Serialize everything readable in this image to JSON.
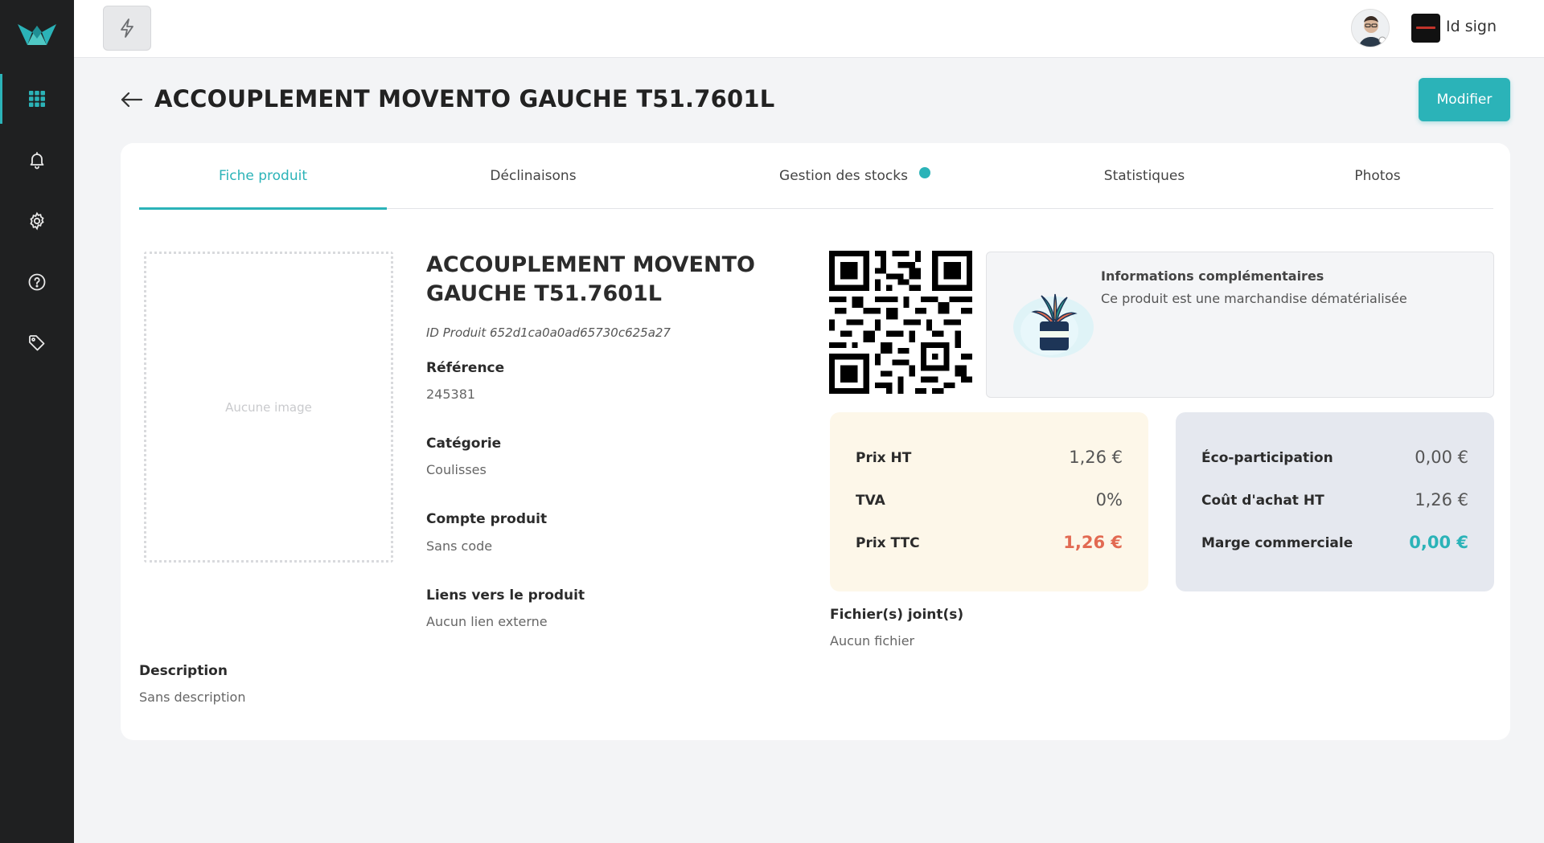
{
  "header": {
    "title": "ACCOUPLEMENT MOVENTO GAUCHE T51.7601L",
    "modify_label": "Modifier"
  },
  "topbar": {
    "company_name": "Id sign"
  },
  "tabs": [
    {
      "label": "Fiche produit",
      "active": true
    },
    {
      "label": "Déclinaisons",
      "active": false
    },
    {
      "label": "Gestion des stocks",
      "active": false
    },
    {
      "label": "Statistiques",
      "active": false
    },
    {
      "label": "Photos",
      "active": false
    }
  ],
  "product": {
    "image_placeholder": "Aucune image",
    "name": "ACCOUPLEMENT MOVENTO GAUCHE T51.7601L",
    "id_text": "ID Produit 652d1ca0a0ad65730c625a27",
    "reference_label": "Référence",
    "reference_value": "245381",
    "category_label": "Catégorie",
    "category_value": "Coulisses",
    "account_label": "Compte produit",
    "account_value": "Sans code",
    "links_label": "Liens vers le produit",
    "links_value": "Aucun lien externe",
    "description_label": "Description",
    "description_value": "Sans description"
  },
  "info": {
    "title": "Informations complémentaires",
    "text": "Ce produit est une marchandise dématérialisée"
  },
  "pricing": {
    "ht_label": "Prix HT",
    "ht_value": "1,26 €",
    "tva_label": "TVA",
    "tva_value": "0%",
    "ttc_label": "Prix TTC",
    "ttc_value": "1,26 €"
  },
  "costs": {
    "eco_label": "Éco-participation",
    "eco_value": "0,00 €",
    "purchase_label": "Coût d'achat HT",
    "purchase_value": "1,26 €",
    "margin_label": "Marge commerciale",
    "margin_value": "0,00 €"
  },
  "files": {
    "label": "Fichier(s) joint(s)",
    "value": "Aucun fichier"
  },
  "colors": {
    "accent": "#2bb3b8",
    "sidebar": "#1f2021",
    "price_highlight": "#e26a52"
  },
  "icons": {
    "sidebar": [
      "grid-icon",
      "bell-icon",
      "gear-icon",
      "help-icon",
      "tag-icon"
    ],
    "topbar": [
      "flash-icon",
      "menu-icon"
    ]
  }
}
